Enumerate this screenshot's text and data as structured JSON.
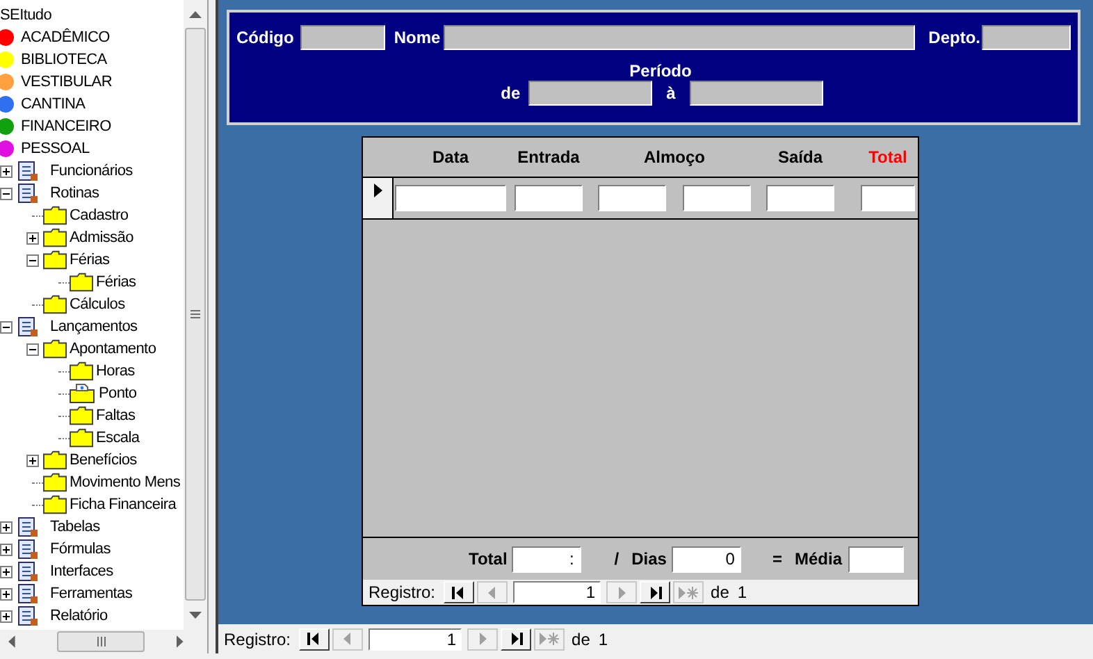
{
  "tree": {
    "items": [
      {
        "label": "SEItudo",
        "kind": "root"
      },
      {
        "label": "ACADÊMICO",
        "kind": "dot",
        "color": "#ff0000"
      },
      {
        "label": "BIBLIOTECA",
        "kind": "dot",
        "color": "#ffff00"
      },
      {
        "label": "VESTIBULAR",
        "kind": "dot",
        "color": "#ffa040"
      },
      {
        "label": "CANTINA",
        "kind": "dot",
        "color": "#3070f0"
      },
      {
        "label": "FINANCEIRO",
        "kind": "dot",
        "color": "#10a010"
      },
      {
        "label": "PESSOAL",
        "kind": "dot",
        "color": "#e010e0"
      },
      {
        "label": "Funcionários",
        "kind": "module",
        "expanded": false
      },
      {
        "label": "Rotinas",
        "kind": "module",
        "expanded": true,
        "children": [
          {
            "label": "Cadastro",
            "kind": "folder"
          },
          {
            "label": "Admissão",
            "kind": "folder",
            "expanded": false
          },
          {
            "label": "Férias",
            "kind": "folder",
            "expanded": true,
            "children": [
              {
                "label": "Férias",
                "kind": "folder"
              }
            ]
          },
          {
            "label": "Cálculos",
            "kind": "folder"
          }
        ]
      },
      {
        "label": "Lançamentos",
        "kind": "module",
        "expanded": true,
        "children": [
          {
            "label": "Apontamento",
            "kind": "folder",
            "expanded": true,
            "children": [
              {
                "label": "Horas",
                "kind": "folder"
              },
              {
                "label": "Ponto",
                "kind": "folder_page"
              },
              {
                "label": "Faltas",
                "kind": "folder"
              },
              {
                "label": "Escala",
                "kind": "folder"
              }
            ]
          },
          {
            "label": "Benefícios",
            "kind": "folder",
            "expanded": false
          },
          {
            "label": "Movimento Mens",
            "kind": "folder"
          },
          {
            "label": "Ficha Financeira",
            "kind": "folder"
          }
        ]
      },
      {
        "label": "Tabelas",
        "kind": "module",
        "expanded": false
      },
      {
        "label": "Fórmulas",
        "kind": "module",
        "expanded": false
      },
      {
        "label": "Interfaces",
        "kind": "module",
        "expanded": false
      },
      {
        "label": "Ferramentas",
        "kind": "module",
        "expanded": false
      },
      {
        "label": "Relatório",
        "kind": "module",
        "expanded": false
      }
    ]
  },
  "header": {
    "fields": [
      {
        "label": "Código",
        "kind": "short"
      },
      {
        "label": "Nome",
        "kind": "wide"
      },
      {
        "label": "Depto.",
        "kind": "short"
      }
    ],
    "period": {
      "title": "Período",
      "from_label": "de",
      "to_label": "à"
    }
  },
  "subform": {
    "columns": [
      {
        "label": "Data",
        "kind": "date"
      },
      {
        "label": "Entrada",
        "kind": "time"
      },
      {
        "label": "Almoço",
        "kind": "time_pair"
      },
      {
        "label": "Saída",
        "kind": "time"
      },
      {
        "label": "Total",
        "kind": "total"
      }
    ],
    "totals": {
      "total_label": "Total",
      "total_value": ":",
      "divider": "/",
      "days_label": "Dias",
      "days_value": "0",
      "equals": "=",
      "average_label": "Média"
    },
    "navigation": {
      "label": "Registro:",
      "record": "1",
      "of": "de",
      "count": "1",
      "buttons": [
        {
          "kind": "first",
          "disabled": false
        },
        {
          "kind": "prev",
          "disabled": true
        },
        {
          "kind": "next",
          "disabled": true
        },
        {
          "kind": "last",
          "disabled": false
        },
        {
          "kind": "new",
          "disabled": true
        }
      ]
    }
  },
  "navigation": {
    "label": "Registro:",
    "record": "1",
    "of": "de",
    "count": "1",
    "buttons": [
      {
        "kind": "first",
        "disabled": false
      },
      {
        "kind": "prev",
        "disabled": true
      },
      {
        "kind": "next",
        "disabled": true
      },
      {
        "kind": "last",
        "disabled": false
      },
      {
        "kind": "new",
        "disabled": true
      }
    ]
  }
}
